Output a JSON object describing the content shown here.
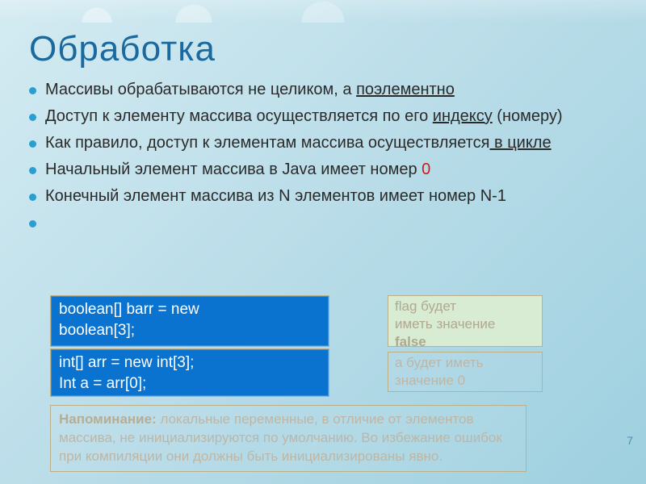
{
  "title": "Обработка",
  "bullets": {
    "b1_pre": "Массивы обрабатываются не целиком, а ",
    "b1_u": "поэлементно",
    "b2_pre": "Доступ к элементу массива осуществляется по его ",
    "b2_u": "индексу",
    "b2_post": " (номеру)",
    "b3_pre": "Как правило, доступ к элементам массива осуществляется",
    "b3_u": " в цикле",
    "b4_pre": "Начальный элемент массива в Java имеет номер ",
    "b4_red": "0",
    "b5": "Конечный элемент массива из N элементов имеет номер N-1"
  },
  "code": {
    "box1_l1": "boolean[] barr = new",
    "box1_l2": "boolean[3];",
    "box2_l1": "int[] arr = new int[3];",
    "box2_l2": "Int a = arr[0];"
  },
  "notes": {
    "n1_l1": "flag будет",
    "n1_l2": "иметь значение",
    "n1_l3": "false",
    "n2_l1": "a будет иметь",
    "n2_l2": "значение 0"
  },
  "reminder": {
    "bold": "Напоминание:",
    "text": " локальные переменные, в отличие от элементов массива, не инициализируются по умолчанию. Во избежание ошибок при компиляции они должны быть инициализированы явно."
  },
  "pagenum": "7"
}
